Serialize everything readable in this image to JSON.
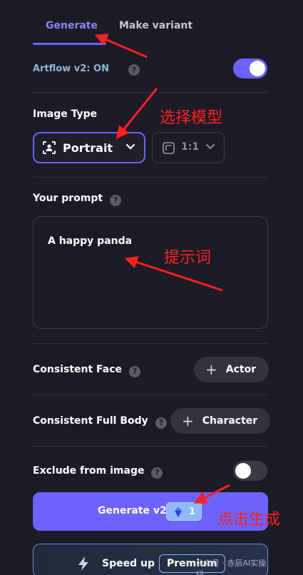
{
  "tabs": [
    {
      "label": "Generate",
      "active": true
    },
    {
      "label": "Make variant",
      "active": false
    }
  ],
  "artflow": {
    "label": "Artflow v2: ON",
    "enabled": true
  },
  "image_type": {
    "label": "Image Type",
    "type_value": "Portrait",
    "ratio_value": "1:1"
  },
  "prompt": {
    "label": "Your prompt",
    "value": "A happy panda"
  },
  "consistent_face": {
    "label": "Consistent Face",
    "button": "Actor"
  },
  "consistent_body": {
    "label": "Consistent Full Body",
    "button": "Character"
  },
  "exclude": {
    "label": "Exclude from image",
    "enabled": false
  },
  "generate": {
    "label": "Generate v2",
    "credits": "1"
  },
  "speed": {
    "label": "Speed up",
    "badge": "Premium",
    "watermark": "公众号 · 赤辰AI实操记"
  },
  "annotations": {
    "model": "选择模型",
    "prompt": "提示词",
    "generate": "点击生成"
  },
  "colors": {
    "accent": "#6c63ff",
    "background": "#1b1b26",
    "annotation": "#ff2020"
  }
}
